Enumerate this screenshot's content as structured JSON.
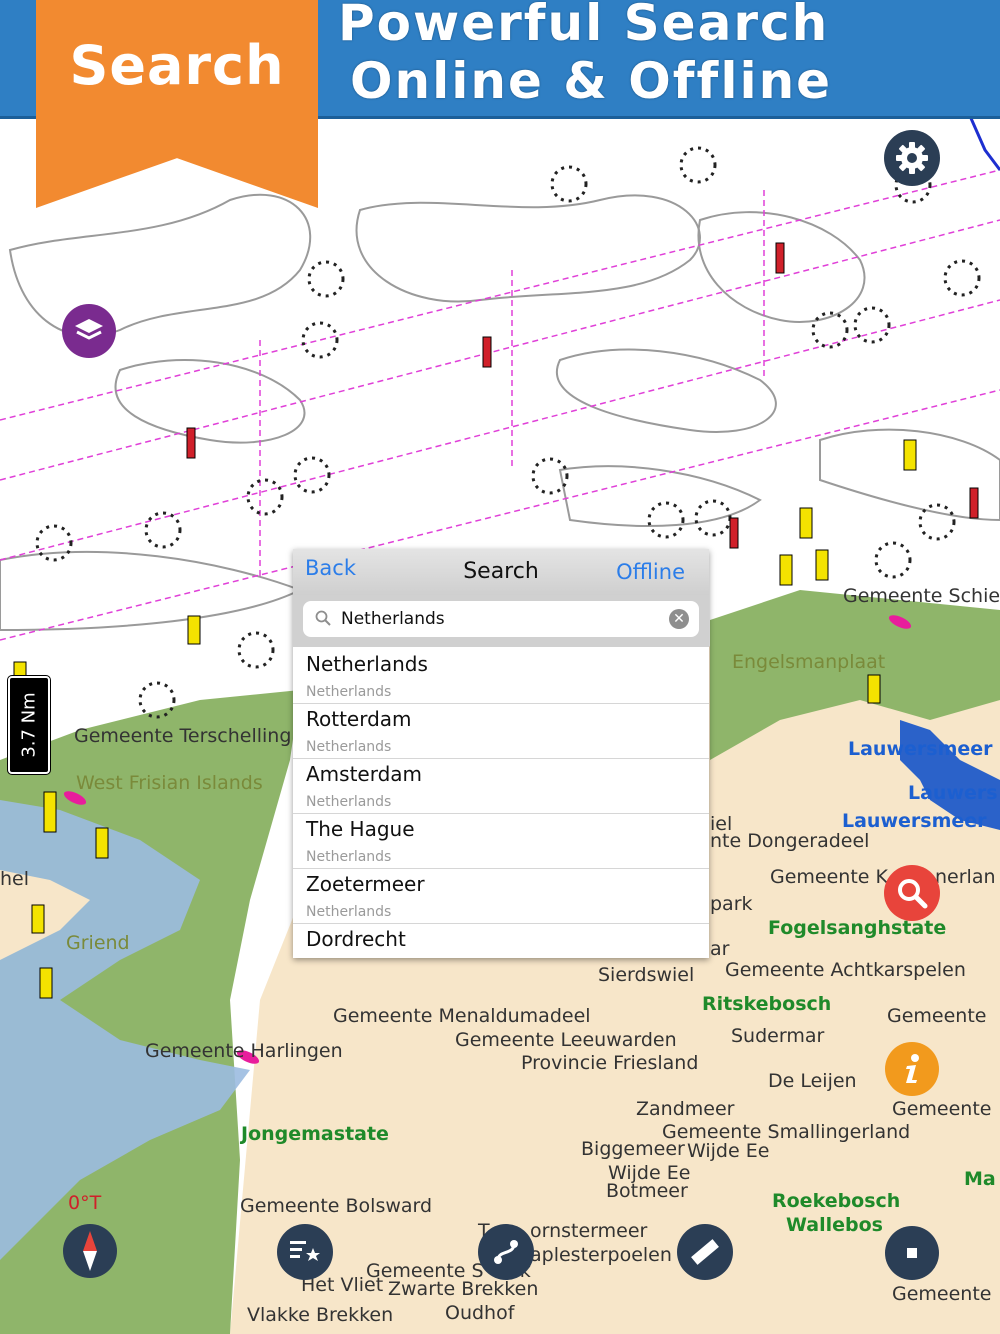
{
  "banner": {
    "ribbon_label": "Search",
    "headline_line1": "Powerful Search",
    "headline_line2": "Online & Offline"
  },
  "colors": {
    "banner_blue": "#2f7fc4",
    "ribbon_orange": "#f28a30",
    "land": "#f7e6c9",
    "water": "#9bbbe0",
    "marsh": "#8fb56a",
    "link_blue": "#2b7de9"
  },
  "scale_bar": {
    "label": "3.7 Nm"
  },
  "heading": {
    "label": "0°T"
  },
  "search_panel": {
    "back_label": "Back",
    "title": "Search",
    "offline_label": "Offline",
    "query": "Netherlands",
    "results": [
      {
        "name": "Netherlands",
        "country": "Netherlands"
      },
      {
        "name": "Rotterdam",
        "country": "Netherlands"
      },
      {
        "name": "Amsterdam",
        "country": "Netherlands"
      },
      {
        "name": "The Hague",
        "country": "Netherlands"
      },
      {
        "name": "Zoetermeer",
        "country": "Netherlands"
      },
      {
        "name": "Dordrecht",
        "country": ""
      }
    ]
  },
  "map_labels": [
    "Gemeente Schie",
    "Engelsmanplaat",
    "Gemeente Terschelling",
    "West Frisian Islands",
    "Lauwersmeer",
    "Lauwers",
    "Lauwersmeer",
    "iel",
    "nte Dongeradeel",
    "Gemeente K",
    "nerlan",
    "park",
    "Fogelsanghstate",
    "ar",
    "Griend",
    "hel",
    "Sierdswiel",
    "Gemeente Achtkarspelen",
    "Ritskebosch",
    "Gemeente Menaldumadeel",
    "Gemeente",
    "Sudermar",
    "Gemeente Leeuwarden",
    "Gemeente Harlingen",
    "Provincie Friesland",
    "De Leijen",
    "Zandmeer",
    "Gemeente",
    "Jongemastate",
    "Gemeente Smallingerland",
    "Biggemeer",
    "Wijde Ee",
    "Wijde Ee",
    "Botmeer",
    "Ma",
    "Gemeente Bolsward",
    "Roekebosch",
    "Wallebos",
    "T",
    "ornstermeer",
    "aplesterpoelen",
    "Gemeente S",
    "ek",
    "Het Vliet",
    "Zwarte Brekken",
    "Gemeente",
    "Vlakke Brekken",
    "Oudhof"
  ]
}
